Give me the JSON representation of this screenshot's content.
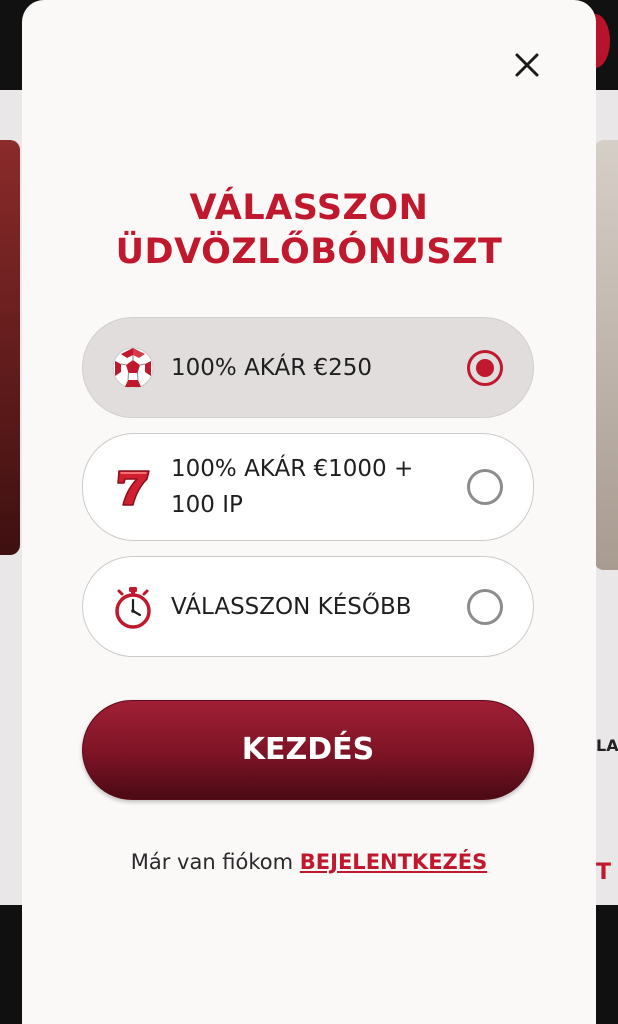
{
  "background": {
    "right_text": "LA",
    "right_red_text": "T"
  },
  "modal": {
    "title_line1": "VÁLASSZON",
    "title_line2": "ÜDVÖZLŐBÓNUSZT",
    "close_icon": "close-icon",
    "options": [
      {
        "icon": "soccer-ball-icon",
        "label": "100% AKÁR €250",
        "selected": true
      },
      {
        "icon": "lucky-seven-icon",
        "label": "100% AKÁR €1000 + 100 IP",
        "selected": false
      },
      {
        "icon": "stopwatch-icon",
        "label": "VÁLASSZON KÉSŐBB",
        "selected": false
      }
    ],
    "cta_label": "KEZDÉS",
    "login_prompt": "Már van fiókom",
    "login_link": "BEJELENTKEZÉS"
  },
  "colors": {
    "accent": "#c0182d",
    "cta_top": "#a01f35",
    "cta_bottom": "#4a0a14",
    "modal_bg": "#fbf8f8",
    "selected_option_bg": "#e1dddd"
  }
}
